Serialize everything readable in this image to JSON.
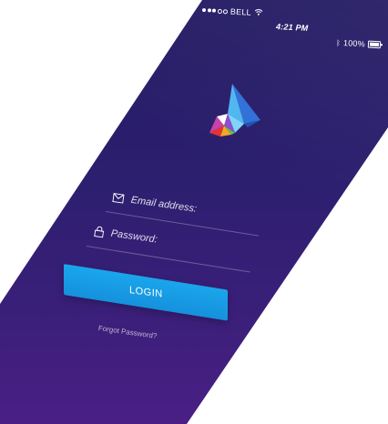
{
  "status_bar": {
    "carrier": "BELL",
    "time": "4:21 PM",
    "battery": "100%"
  },
  "logo": {
    "icon": "triangle-prism-logo",
    "colors": [
      "#2f6fd8",
      "#4fb6f0",
      "#7ed3f7",
      "#e3332f",
      "#f6a524",
      "#5bbf4a",
      "#8e4bd2",
      "#ffffff"
    ]
  },
  "login_form": {
    "email_placeholder": "Email address:",
    "password_placeholder": "Password:",
    "login_label": "LOGIN",
    "forgot_label": "Forgot Password?"
  },
  "colors": {
    "background_top": "#231a63",
    "background_bottom": "#4a1f85",
    "button": "#1aa6ec"
  }
}
